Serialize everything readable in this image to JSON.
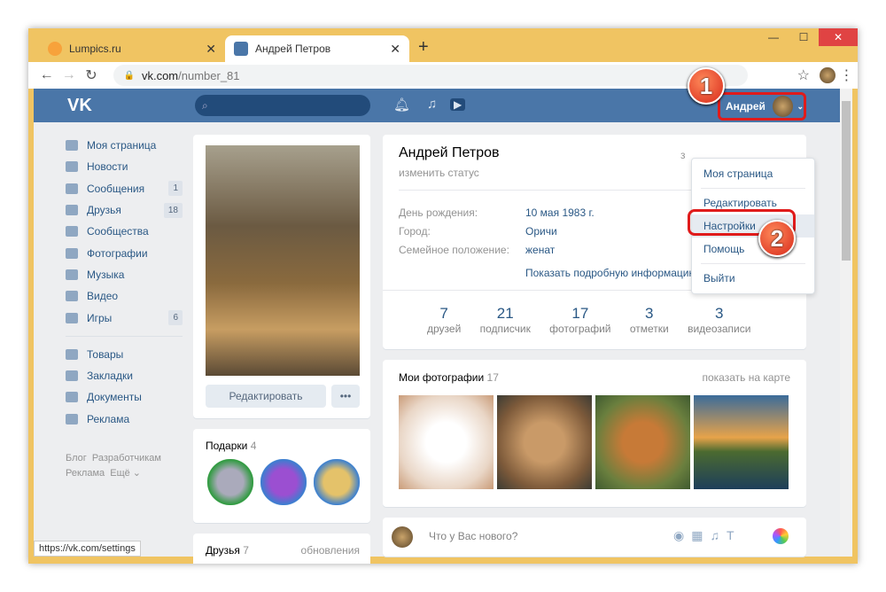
{
  "browser": {
    "tabs": [
      {
        "title": "Lumpics.ru"
      },
      {
        "title": "Андрей Петров"
      }
    ],
    "url_host": "vk.com",
    "url_path": "/number_81",
    "status_url": "https://vk.com/settings"
  },
  "header": {
    "logo": "VK",
    "user_name": "Андрей"
  },
  "sidebar": {
    "items": [
      {
        "label": "Моя страница"
      },
      {
        "label": "Новости"
      },
      {
        "label": "Сообщения",
        "count": "1"
      },
      {
        "label": "Друзья",
        "count": "18"
      },
      {
        "label": "Сообщества"
      },
      {
        "label": "Фотографии"
      },
      {
        "label": "Музыка"
      },
      {
        "label": "Видео"
      },
      {
        "label": "Игры",
        "count": "6"
      }
    ],
    "items2": [
      {
        "label": "Товары"
      },
      {
        "label": "Закладки"
      },
      {
        "label": "Документы"
      },
      {
        "label": "Реклама"
      }
    ],
    "footer": [
      "Блог",
      "Разработчикам",
      "Реклама",
      "Ещё ⌄"
    ]
  },
  "profile": {
    "edit_label": "Редактировать",
    "more": "•••",
    "gifts_title": "Подарки",
    "gifts_count": "4",
    "friends_title": "Друзья",
    "friends_count": "7",
    "friends_updates": "обновления",
    "name": "Андрей Петров",
    "status": "изменить статус",
    "online": "з",
    "info": [
      {
        "k": "День рождения:",
        "v": "10 мая 1983 г."
      },
      {
        "k": "Город:",
        "v": "Оричи"
      },
      {
        "k": "Семейное положение:",
        "v": "женат"
      }
    ],
    "show_more": "Показать подробную информацию",
    "stats": [
      {
        "n": "7",
        "l": "друзей"
      },
      {
        "n": "21",
        "l": "подписчик"
      },
      {
        "n": "17",
        "l": "фотографий"
      },
      {
        "n": "3",
        "l": "отметки"
      },
      {
        "n": "3",
        "l": "видеозаписи"
      }
    ],
    "photos_title": "Мои фотографии",
    "photos_count": "17",
    "photos_map": "показать на карте",
    "post_placeholder": "Что у Вас нового?"
  },
  "menu": {
    "items": [
      "Моя страница",
      "Редактировать",
      "Настройки",
      "Помощь",
      "Выйти"
    ]
  },
  "annotations": [
    "1",
    "2"
  ]
}
